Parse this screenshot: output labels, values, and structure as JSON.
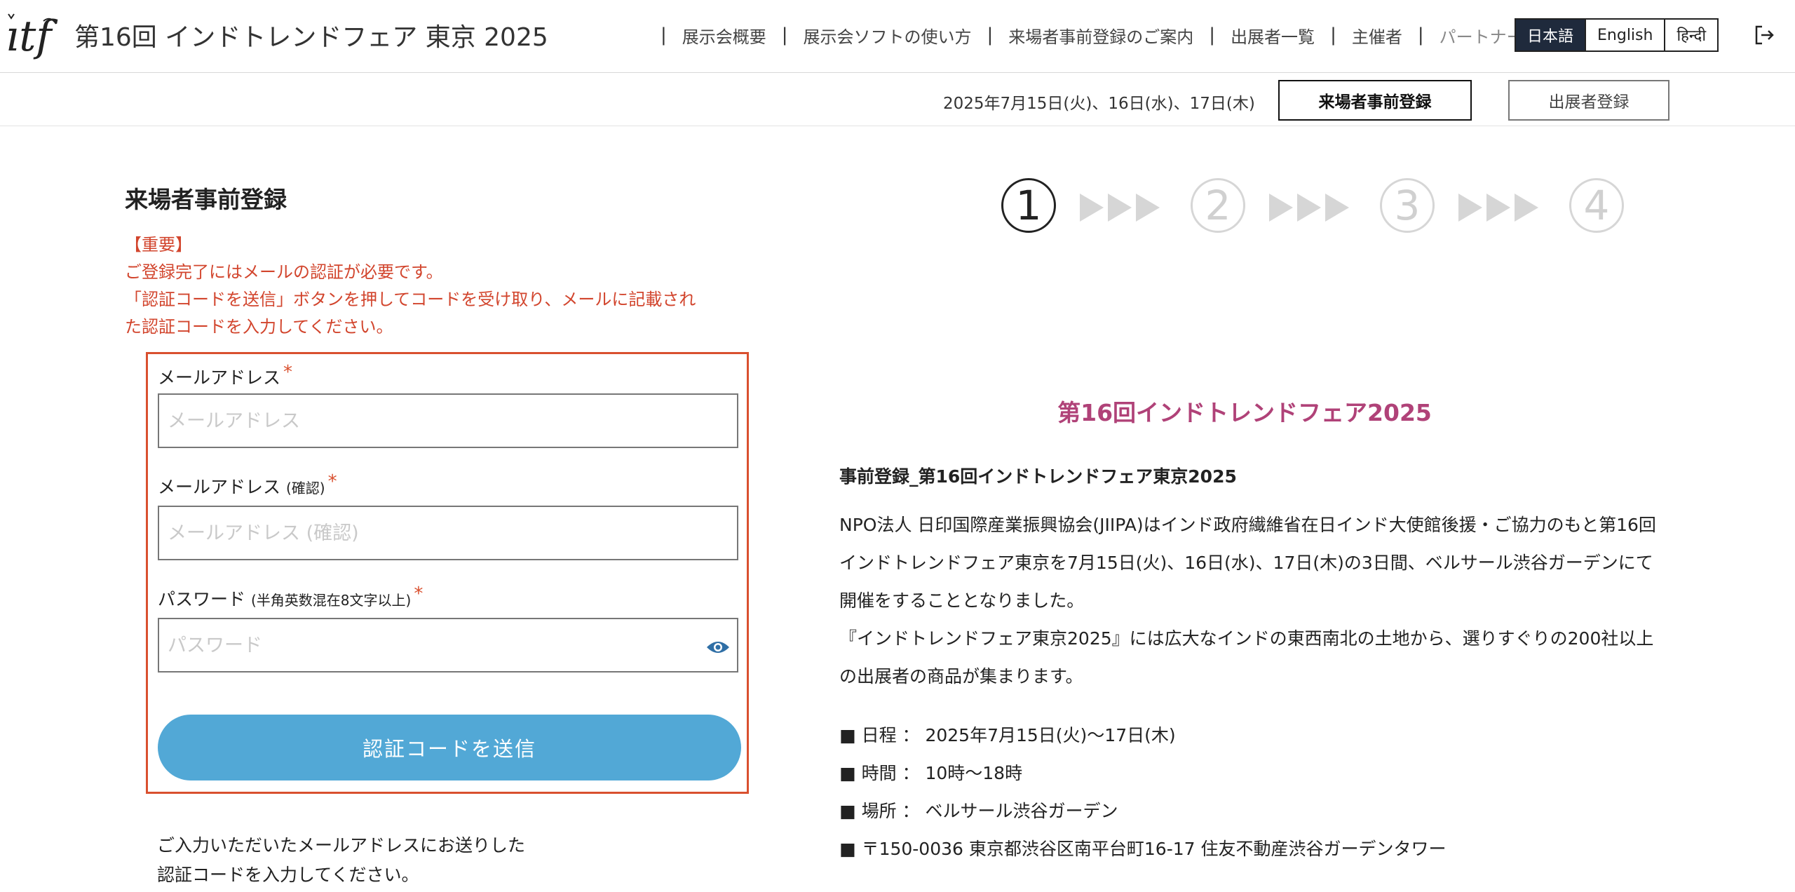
{
  "header": {
    "title": "第16回 インドトレンドフェア 東京 2025",
    "nav": [
      {
        "label": "展示会概要"
      },
      {
        "label": "展示会ソフトの使い方"
      },
      {
        "label": "来場者事前登録のご案内"
      },
      {
        "label": "出展者一覧"
      },
      {
        "label": "主催者"
      },
      {
        "label": "パートナー"
      }
    ],
    "languages": [
      {
        "label": "日本語"
      },
      {
        "label": "English"
      },
      {
        "label": "हिन्दी"
      }
    ]
  },
  "subheader": {
    "dates": "2025年7月15日(火)、16日(水)、17日(木)",
    "visitor_button": "来場者事前登録",
    "exhibitor_button": "出展者登録"
  },
  "form": {
    "page_title": "来場者事前登録",
    "notice": [
      "【重要】",
      "ご登録完了にはメールの認証が必要です。",
      "「認証コードを送信」ボタンを押してコードを受け取り、メールに記載され",
      "た認証コードを入力してください。"
    ],
    "email_label": "メールアドレス",
    "email_placeholder": "メールアドレス",
    "email_confirm_label": "メールアドレス",
    "email_confirm_note": "(確認)",
    "email_confirm_placeholder": "メールアドレス (確認)",
    "password_label": "パスワード",
    "password_note": "(半角英数混在8文字以上)",
    "password_placeholder": "パスワード",
    "required_mark": "*",
    "send_button": "認証コードを送信",
    "after_text": [
      "ご入力いただいたメールアドレスにお送りした",
      "認証コードを入力してください。"
    ]
  },
  "steps": [
    {
      "label": "1"
    },
    {
      "label": "2"
    },
    {
      "label": "3"
    },
    {
      "label": "4"
    }
  ],
  "event": {
    "title": "第16回インドトレンドフェア2025",
    "subtitle": "事前登録_第16回インドトレンドフェア東京2025",
    "description_1": "NPO法人 日印国際産業振興協会(JIIPA)はインド政府繊維省在日インド大使館後援・ご協力のもと第16回インドトレンドフェア東京を7月15日(火)、16日(水)、17日(木)の3日間、ベルサール渋谷ガーデンにて開催をすることとなりました。",
    "description_2": "『インドトレンドフェア東京2025』には広大なインドの東西南北の土地から、選りすぐりの200社以上の出展者の商品が集まります。",
    "info": [
      "■ 日程 ： 2025年7月15日(火)〜17日(木)",
      "■ 時間 ： 10時〜18時",
      "■ 場所 ： ベルサール渋谷ガーデン",
      "■ 〒150-0036 東京都渋谷区南平台町16-17 住友不動産渋谷ガーデンタワー"
    ]
  },
  "colors": {
    "accent_red": "#d9502f",
    "button_blue": "#52a8d6",
    "title_magenta": "#b04278",
    "lang_active": "#1f2a3c"
  },
  "icons": [
    "itf-logo",
    "logout-icon",
    "eye-icon",
    "triple-arrow-icon"
  ]
}
